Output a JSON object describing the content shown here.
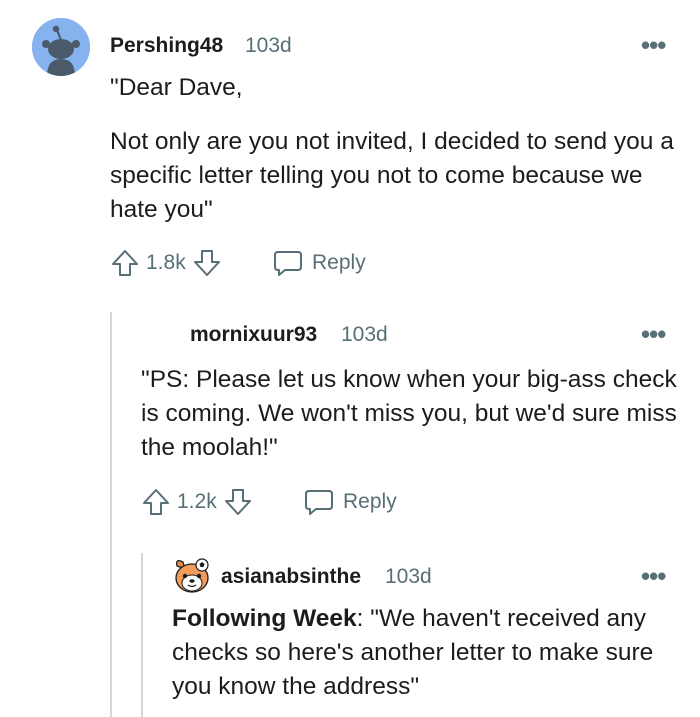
{
  "comments": [
    {
      "author": "Pershing48",
      "age": "103d",
      "body": [
        "\"Dear Dave,",
        "Not only are you not invited, I decided to send you a specific letter telling you not to come because we hate you\""
      ],
      "score": "1.8k",
      "reply_label": "Reply",
      "avatar_icon": "snoo-avatar-icon",
      "avatar_color": "#86b3ee"
    },
    {
      "author": "mornixuur93",
      "age": "103d",
      "body": "\"PS: Please let us know when your big-ass check is coming. We won't miss you, but we'd sure miss the moolah!\"",
      "score": "1.2k",
      "reply_label": "Reply"
    },
    {
      "author": "asianabsinthe",
      "age": "103d",
      "body_bold": "Following Week",
      "body_rest": ": \"We haven't received any checks so here's another letter to make sure you know the address\"",
      "avatar_icon": "dog-avatar-icon"
    }
  ],
  "colors": {
    "meta_text": "#576f76",
    "thread_line": "#d6d6d6",
    "avatar_blue": "#86b3ee"
  }
}
